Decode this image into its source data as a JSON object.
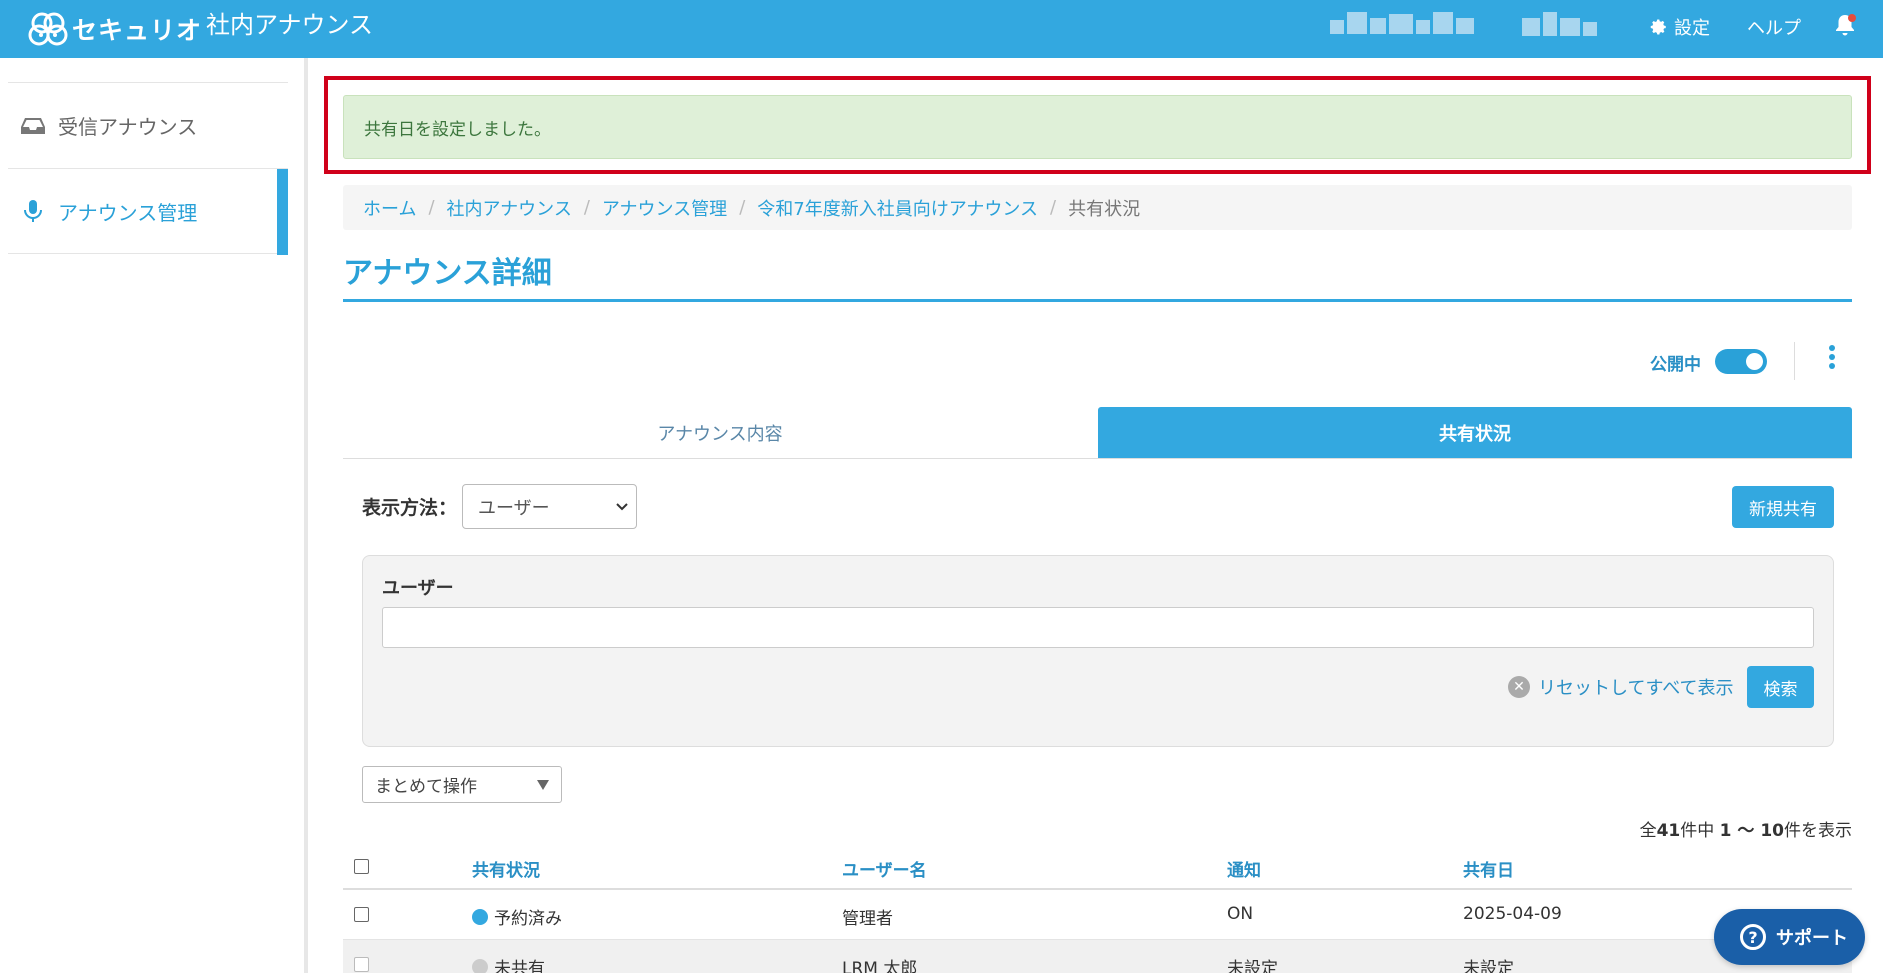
{
  "header": {
    "logo_text": "セキュリオ",
    "app_title": "社内アナウンス",
    "settings_label": "設定",
    "help_label": "ヘルプ",
    "icons": {
      "settings": "gear-icon",
      "notifications": "bell-icon",
      "logo": "logo-icon"
    }
  },
  "sidebar": {
    "items": [
      {
        "label": "受信アナウンス",
        "icon": "inbox-icon",
        "active": false
      },
      {
        "label": "アナウンス管理",
        "icon": "microphone-icon",
        "active": true
      }
    ]
  },
  "alert": {
    "message": "共有日を設定しました。"
  },
  "breadcrumb": {
    "items": [
      "ホーム",
      "社内アナウンス",
      "アナウンス管理",
      "令和7年度新入社員向けアナウンス",
      "共有状況"
    ]
  },
  "page": {
    "title": "アナウンス詳細",
    "publish_label": "公開中",
    "publish_on": true
  },
  "tabs": [
    {
      "label": "アナウンス内容",
      "active": false
    },
    {
      "label": "共有状況",
      "active": true
    }
  ],
  "view": {
    "label": "表示方法：",
    "selected": "ユーザー",
    "new_share_button": "新規共有"
  },
  "filter": {
    "user_label": "ユーザー",
    "user_value": "",
    "reset_label": "リセットしてすべて表示",
    "search_button": "検索"
  },
  "bulk": {
    "label": "まとめて操作"
  },
  "count": {
    "prefix": "全",
    "total": "41",
    "mid": "件中",
    "range": "1 ～ 10",
    "suffix": "件を表示"
  },
  "table": {
    "columns": [
      "共有状況",
      "ユーザー名",
      "通知",
      "共有日"
    ],
    "rows": [
      {
        "status": "予約済み",
        "status_color": "#33a8e0",
        "user": "管理者",
        "notify": "ON",
        "date": "2025-04-09"
      },
      {
        "status": "未共有",
        "status_color": "#cccccc",
        "user": "LRM 太郎",
        "notify": "未設定",
        "date": "未設定"
      }
    ]
  },
  "support": {
    "label": "サポート"
  },
  "colors": {
    "brand": "#33a8e0",
    "alert_bg": "#dff0d8",
    "highlight_frame": "#d0001a"
  }
}
